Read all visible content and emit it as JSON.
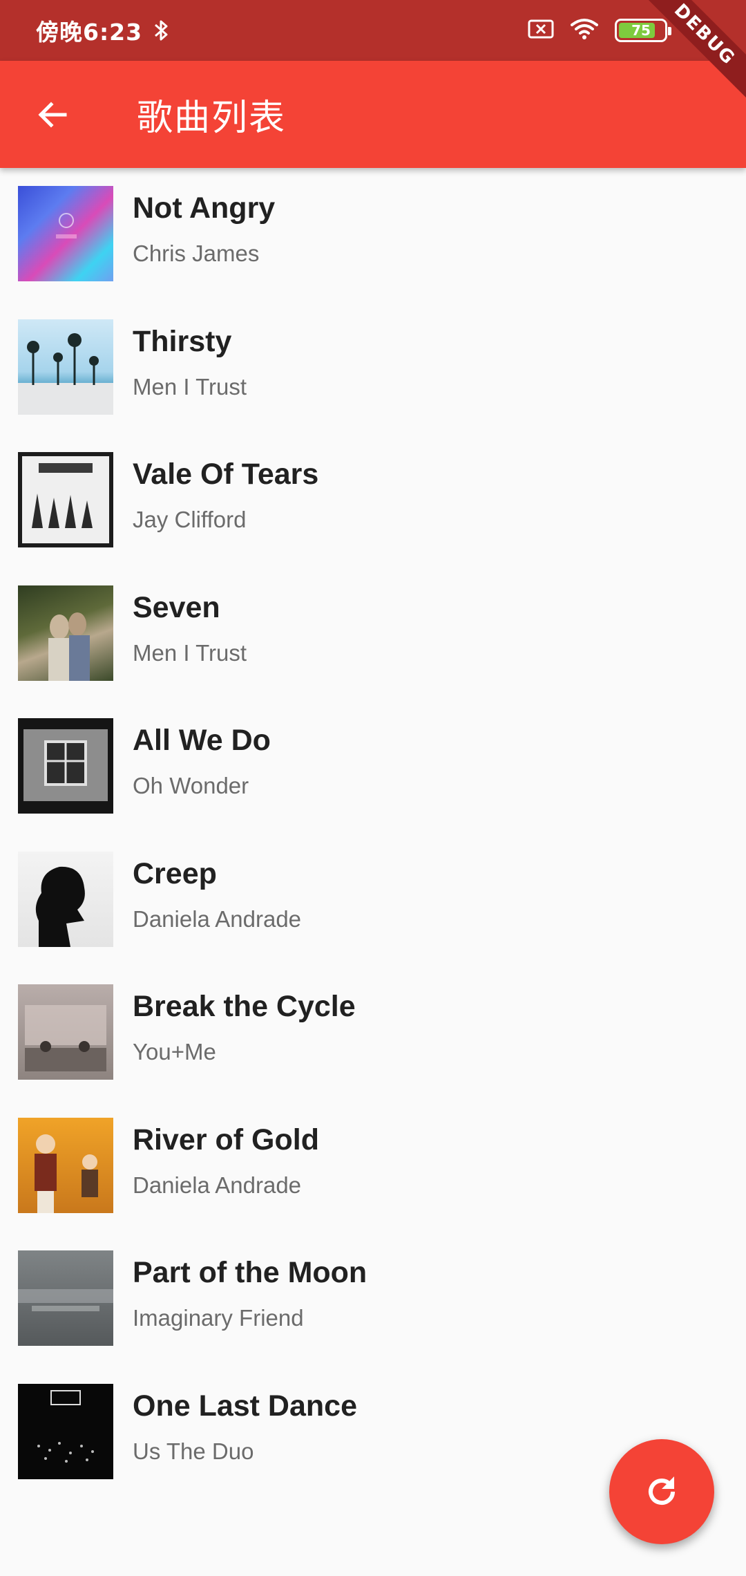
{
  "status_bar": {
    "time": "傍晚6:23",
    "battery": "75",
    "debug_banner": "DEBUG"
  },
  "app_bar": {
    "title": "歌曲列表",
    "background": "#f44336"
  },
  "songs": [
    {
      "title": "Not Angry",
      "artist": "Chris James"
    },
    {
      "title": "Thirsty",
      "artist": "Men I Trust"
    },
    {
      "title": "Vale Of Tears",
      "artist": "Jay Clifford"
    },
    {
      "title": "Seven",
      "artist": "Men I Trust"
    },
    {
      "title": "All We Do",
      "artist": "Oh Wonder"
    },
    {
      "title": "Creep",
      "artist": "Daniela Andrade"
    },
    {
      "title": "Break the Cycle",
      "artist": "You+Me"
    },
    {
      "title": "River of Gold",
      "artist": "Daniela Andrade"
    },
    {
      "title": "Part of the Moon",
      "artist": "Imaginary Friend"
    },
    {
      "title": "One Last Dance",
      "artist": "Us The Duo"
    }
  ],
  "icons": {
    "back": "arrow-back-icon",
    "fab": "refresh-icon",
    "bluetooth": "bluetooth-icon",
    "wifi": "wifi-icon",
    "sim": "no-sim-icon",
    "charging": "charging-bolt-icon"
  },
  "colors": {
    "accent": "#f44336",
    "status_bar": "#b4302b"
  }
}
